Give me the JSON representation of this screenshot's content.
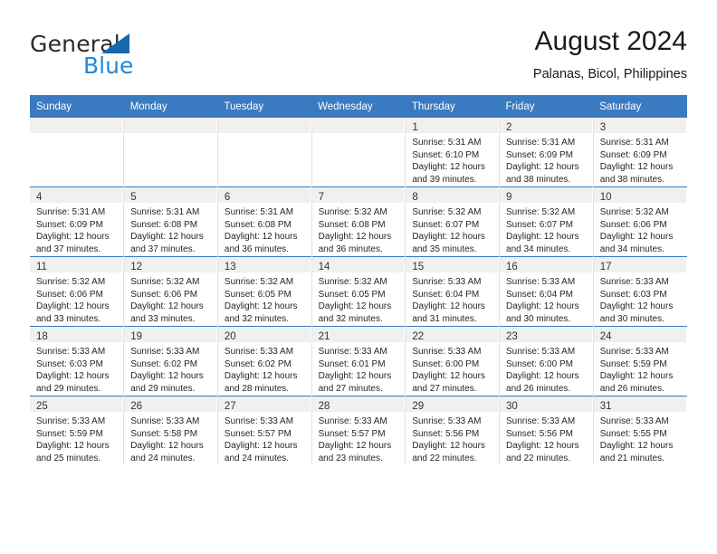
{
  "brand": {
    "name_top": "General",
    "name_bottom": "Blue",
    "triangle_color": "#1667b0",
    "blue_color": "#2288d8"
  },
  "header": {
    "title": "August 2024",
    "subtitle": "Palanas, Bicol, Philippines"
  },
  "theme": {
    "header_blue": "#3a7ac0",
    "daynum_band": "#f0f0f0",
    "cell_border": "#e3e3e3"
  },
  "weekdays": [
    "Sunday",
    "Monday",
    "Tuesday",
    "Wednesday",
    "Thursday",
    "Friday",
    "Saturday"
  ],
  "labels": {
    "sunrise_prefix": "Sunrise:",
    "sunset_prefix": "Sunset:",
    "daylight_prefix": "Daylight:"
  },
  "weeks": [
    [
      {
        "day": "",
        "sunrise": "",
        "sunset": "",
        "daylight": ""
      },
      {
        "day": "",
        "sunrise": "",
        "sunset": "",
        "daylight": ""
      },
      {
        "day": "",
        "sunrise": "",
        "sunset": "",
        "daylight": ""
      },
      {
        "day": "",
        "sunrise": "",
        "sunset": "",
        "daylight": ""
      },
      {
        "day": "1",
        "sunrise": "Sunrise: 5:31 AM",
        "sunset": "Sunset: 6:10 PM",
        "daylight": "Daylight: 12 hours and 39 minutes."
      },
      {
        "day": "2",
        "sunrise": "Sunrise: 5:31 AM",
        "sunset": "Sunset: 6:09 PM",
        "daylight": "Daylight: 12 hours and 38 minutes."
      },
      {
        "day": "3",
        "sunrise": "Sunrise: 5:31 AM",
        "sunset": "Sunset: 6:09 PM",
        "daylight": "Daylight: 12 hours and 38 minutes."
      }
    ],
    [
      {
        "day": "4",
        "sunrise": "Sunrise: 5:31 AM",
        "sunset": "Sunset: 6:09 PM",
        "daylight": "Daylight: 12 hours and 37 minutes."
      },
      {
        "day": "5",
        "sunrise": "Sunrise: 5:31 AM",
        "sunset": "Sunset: 6:08 PM",
        "daylight": "Daylight: 12 hours and 37 minutes."
      },
      {
        "day": "6",
        "sunrise": "Sunrise: 5:31 AM",
        "sunset": "Sunset: 6:08 PM",
        "daylight": "Daylight: 12 hours and 36 minutes."
      },
      {
        "day": "7",
        "sunrise": "Sunrise: 5:32 AM",
        "sunset": "Sunset: 6:08 PM",
        "daylight": "Daylight: 12 hours and 36 minutes."
      },
      {
        "day": "8",
        "sunrise": "Sunrise: 5:32 AM",
        "sunset": "Sunset: 6:07 PM",
        "daylight": "Daylight: 12 hours and 35 minutes."
      },
      {
        "day": "9",
        "sunrise": "Sunrise: 5:32 AM",
        "sunset": "Sunset: 6:07 PM",
        "daylight": "Daylight: 12 hours and 34 minutes."
      },
      {
        "day": "10",
        "sunrise": "Sunrise: 5:32 AM",
        "sunset": "Sunset: 6:06 PM",
        "daylight": "Daylight: 12 hours and 34 minutes."
      }
    ],
    [
      {
        "day": "11",
        "sunrise": "Sunrise: 5:32 AM",
        "sunset": "Sunset: 6:06 PM",
        "daylight": "Daylight: 12 hours and 33 minutes."
      },
      {
        "day": "12",
        "sunrise": "Sunrise: 5:32 AM",
        "sunset": "Sunset: 6:06 PM",
        "daylight": "Daylight: 12 hours and 33 minutes."
      },
      {
        "day": "13",
        "sunrise": "Sunrise: 5:32 AM",
        "sunset": "Sunset: 6:05 PM",
        "daylight": "Daylight: 12 hours and 32 minutes."
      },
      {
        "day": "14",
        "sunrise": "Sunrise: 5:32 AM",
        "sunset": "Sunset: 6:05 PM",
        "daylight": "Daylight: 12 hours and 32 minutes."
      },
      {
        "day": "15",
        "sunrise": "Sunrise: 5:33 AM",
        "sunset": "Sunset: 6:04 PM",
        "daylight": "Daylight: 12 hours and 31 minutes."
      },
      {
        "day": "16",
        "sunrise": "Sunrise: 5:33 AM",
        "sunset": "Sunset: 6:04 PM",
        "daylight": "Daylight: 12 hours and 30 minutes."
      },
      {
        "day": "17",
        "sunrise": "Sunrise: 5:33 AM",
        "sunset": "Sunset: 6:03 PM",
        "daylight": "Daylight: 12 hours and 30 minutes."
      }
    ],
    [
      {
        "day": "18",
        "sunrise": "Sunrise: 5:33 AM",
        "sunset": "Sunset: 6:03 PM",
        "daylight": "Daylight: 12 hours and 29 minutes."
      },
      {
        "day": "19",
        "sunrise": "Sunrise: 5:33 AM",
        "sunset": "Sunset: 6:02 PM",
        "daylight": "Daylight: 12 hours and 29 minutes."
      },
      {
        "day": "20",
        "sunrise": "Sunrise: 5:33 AM",
        "sunset": "Sunset: 6:02 PM",
        "daylight": "Daylight: 12 hours and 28 minutes."
      },
      {
        "day": "21",
        "sunrise": "Sunrise: 5:33 AM",
        "sunset": "Sunset: 6:01 PM",
        "daylight": "Daylight: 12 hours and 27 minutes."
      },
      {
        "day": "22",
        "sunrise": "Sunrise: 5:33 AM",
        "sunset": "Sunset: 6:00 PM",
        "daylight": "Daylight: 12 hours and 27 minutes."
      },
      {
        "day": "23",
        "sunrise": "Sunrise: 5:33 AM",
        "sunset": "Sunset: 6:00 PM",
        "daylight": "Daylight: 12 hours and 26 minutes."
      },
      {
        "day": "24",
        "sunrise": "Sunrise: 5:33 AM",
        "sunset": "Sunset: 5:59 PM",
        "daylight": "Daylight: 12 hours and 26 minutes."
      }
    ],
    [
      {
        "day": "25",
        "sunrise": "Sunrise: 5:33 AM",
        "sunset": "Sunset: 5:59 PM",
        "daylight": "Daylight: 12 hours and 25 minutes."
      },
      {
        "day": "26",
        "sunrise": "Sunrise: 5:33 AM",
        "sunset": "Sunset: 5:58 PM",
        "daylight": "Daylight: 12 hours and 24 minutes."
      },
      {
        "day": "27",
        "sunrise": "Sunrise: 5:33 AM",
        "sunset": "Sunset: 5:57 PM",
        "daylight": "Daylight: 12 hours and 24 minutes."
      },
      {
        "day": "28",
        "sunrise": "Sunrise: 5:33 AM",
        "sunset": "Sunset: 5:57 PM",
        "daylight": "Daylight: 12 hours and 23 minutes."
      },
      {
        "day": "29",
        "sunrise": "Sunrise: 5:33 AM",
        "sunset": "Sunset: 5:56 PM",
        "daylight": "Daylight: 12 hours and 22 minutes."
      },
      {
        "day": "30",
        "sunrise": "Sunrise: 5:33 AM",
        "sunset": "Sunset: 5:56 PM",
        "daylight": "Daylight: 12 hours and 22 minutes."
      },
      {
        "day": "31",
        "sunrise": "Sunrise: 5:33 AM",
        "sunset": "Sunset: 5:55 PM",
        "daylight": "Daylight: 12 hours and 21 minutes."
      }
    ]
  ]
}
